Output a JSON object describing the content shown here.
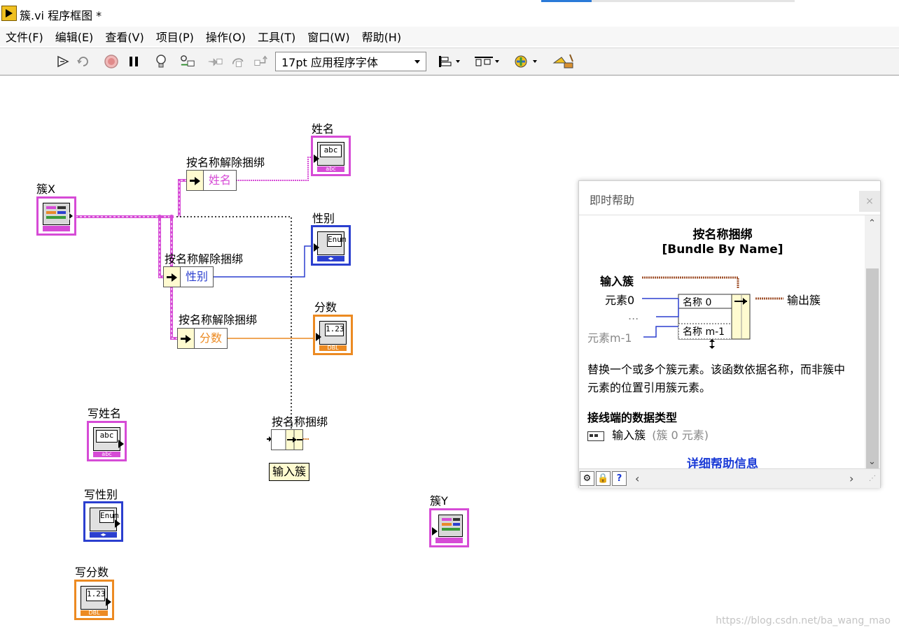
{
  "window": {
    "title": "簇.vi 程序框图 *"
  },
  "menu": [
    "文件(F)",
    "编辑(E)",
    "查看(V)",
    "项目(P)",
    "操作(O)",
    "工具(T)",
    "窗口(W)",
    "帮助(H)"
  ],
  "toolbar": {
    "font_select": "17pt 应用程序字体",
    "icons": [
      "run-arrow-icon",
      "run-continuous-icon",
      "abort-icon",
      "pause-icon",
      "highlight-execution-icon",
      "retain-wire-values-icon",
      "step-into-icon",
      "step-over-icon",
      "step-out-icon",
      "align-objects-icon",
      "distribute-objects-icon",
      "reorder-icon",
      "cleanup-diagram-icon"
    ]
  },
  "diagram": {
    "labels": {
      "cluster_x": "簇X",
      "name_out": "姓名",
      "gender_out": "性别",
      "score_out": "分数",
      "unbundle1": "按名称解除捆绑",
      "unbundle2": "按名称解除捆绑",
      "unbundle3": "按名称解除捆绑",
      "write_name": "写姓名",
      "write_gender": "写性别",
      "write_score": "写分数",
      "bundle": "按名称捆绑",
      "cluster_y": "簇Y"
    },
    "unbundle_fields": [
      "姓名",
      "性别",
      "分数"
    ],
    "terminal_text": {
      "abc": "abc",
      "abc_foot": "abc",
      "enum": "Enum",
      "enum_foot": "◂▸",
      "dbl": "1.23",
      "dbl_foot": "DBL"
    },
    "bundle_tip": "输入簇",
    "colors": {
      "cluster_wire": "#d64bd6",
      "string_wire": "#d64bd6",
      "enum_wire": "#2b3fcf",
      "dbl_wire": "#ec8a22",
      "cluster_node_fill": "#fffbd0"
    }
  },
  "help": {
    "title": "即时帮助",
    "close": "×",
    "function_cn": "按名称捆绑",
    "function_en": "[Bundle By Name]",
    "diagram": {
      "input_cluster": "输入簇",
      "element0": "元素0",
      "ellipsis": "...",
      "element_m1": "元素m-1",
      "name0": "名称 0",
      "name_m1": "名称 m-1",
      "output_cluster": "输出簇"
    },
    "description": "替换一个或多个簇元素。该函数依据名称，而非簇中元素的位置引用簇元素。",
    "terminal_types_heading": "接线端的数据类型",
    "terminal_type_name": "输入簇",
    "terminal_type_detail": "(簇 0 元素)",
    "detail_link": "详细帮助信息",
    "bottom_buttons": [
      "⚙",
      "🔒",
      "?"
    ]
  },
  "watermark": "https://blog.csdn.net/ba_wang_mao"
}
